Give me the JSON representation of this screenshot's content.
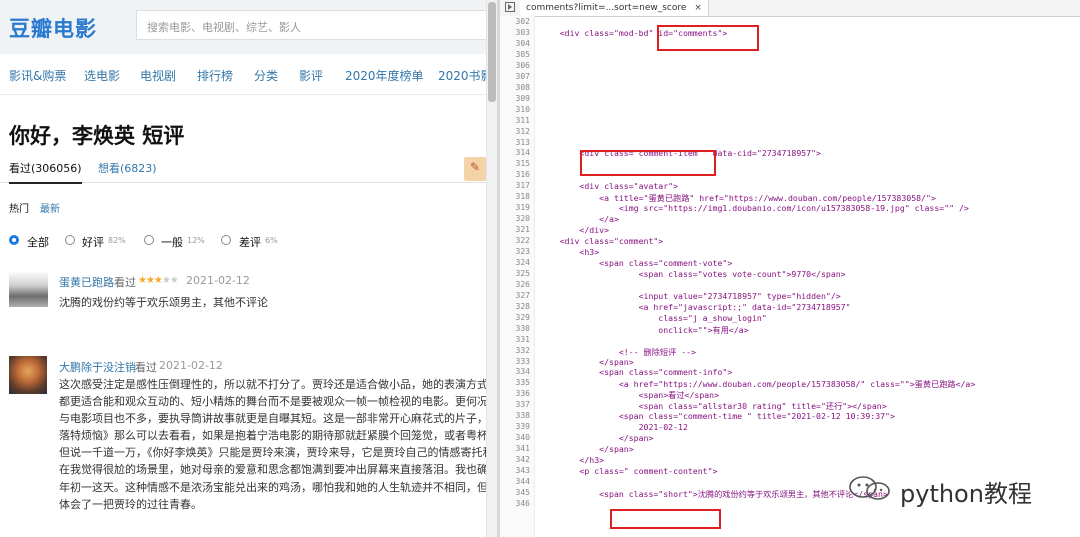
{
  "left_page": {
    "logo": "豆瓣电影",
    "search_placeholder": "搜索电影、电视剧、综艺、影人",
    "nav": [
      "影讯&购票",
      "选电影",
      "电视剧",
      "排行榜",
      "分类",
      "影评",
      "2020年度榜单",
      "2020书影"
    ],
    "title": "你好，李焕英 短评",
    "tabs": {
      "seen": "看过(306056)",
      "want_label": "想看",
      "want_count": "(6823)"
    },
    "sort": {
      "hot": "热门",
      "new": "最新"
    },
    "filters": [
      {
        "label": "全部",
        "pct": "",
        "selected": true
      },
      {
        "label": "好评",
        "pct": "82%",
        "selected": false
      },
      {
        "label": "一般",
        "pct": "12%",
        "selected": false
      },
      {
        "label": "差评",
        "pct": "6%",
        "selected": false
      }
    ],
    "comments": [
      {
        "user": "蛋黄已跑路",
        "status": "看过",
        "stars": 3,
        "date": "2021-02-12",
        "text": [
          "沈腾的戏份约等于欢乐颂男主，其他不评论"
        ]
      },
      {
        "user": "大鹏除于没注销",
        "status": "看过",
        "stars": 0,
        "date": "2021-02-12",
        "text": [
          "这次感受注定是感性压倒理性的，所以就不打分了。贾玲还是适合做小品，她的表演方式、她",
          "都更适合能和观众互动的、短小精炼的舞台而不是要被观众一帧一帧检视的电影。更何况她非",
          "与电影项目也不多，要执导筒讲故事就更是自曝其短。这是一部非常开心麻花式的片子，如果",
          "落特烦恼》那么可以去看看，如果是抱着宁浩电影的期待那就赶紧膜个回笼觉，或者粤杯咖啡",
          "但说一千道一万，《你好李焕英》只能是贾玲来演，贾玲来导，它是贾玲自己的情感寄托和内",
          "在我觉得很尬的场景里，她对母亲的爱意和思念都饱满到要冲出屏幕来直接落泪。我也确实接",
          "年初一这天。这种情感不是浓汤宝能兑出来的鸡汤，哪怕我和她的人生轨迹并不相同，但我也",
          "体会了一把贾玲的过往青春。"
        ]
      }
    ]
  },
  "devtools": {
    "tab_title": "comments?limit=...sort=new_score",
    "close": "×",
    "lines": [
      {
        "n": "302",
        "t": ""
      },
      {
        "n": "303",
        "t": "    <div class=\"mod-bd\" id=\"comments\">"
      },
      {
        "n": "304",
        "t": ""
      },
      {
        "n": "305",
        "t": ""
      },
      {
        "n": "306",
        "t": ""
      },
      {
        "n": "307",
        "t": ""
      },
      {
        "n": "308",
        "t": ""
      },
      {
        "n": "309",
        "t": ""
      },
      {
        "n": "310",
        "t": ""
      },
      {
        "n": "311",
        "t": ""
      },
      {
        "n": "312",
        "t": ""
      },
      {
        "n": "313",
        "t": ""
      },
      {
        "n": "314",
        "t": "        <div class=\"comment-item \" data-cid=\"2734718957\">"
      },
      {
        "n": "315",
        "t": ""
      },
      {
        "n": "316",
        "t": ""
      },
      {
        "n": "317",
        "t": "        <div class=\"avatar\">"
      },
      {
        "n": "318",
        "t": "            <a title=\"蛋黄已跑路\" href=\"https://www.douban.com/people/157383058/\">"
      },
      {
        "n": "319",
        "t": "                <img src=\"https://img1.doubanio.com/icon/u157383058-19.jpg\" class=\"\" />"
      },
      {
        "n": "320",
        "t": "            </a>"
      },
      {
        "n": "321",
        "t": "        </div>"
      },
      {
        "n": "322",
        "t": "    <div class=\"comment\">"
      },
      {
        "n": "323",
        "t": "        <h3>"
      },
      {
        "n": "324",
        "t": "            <span class=\"comment-vote\">"
      },
      {
        "n": "325",
        "t": "                    <span class=\"votes vote-count\">9770</span>"
      },
      {
        "n": "326",
        "t": ""
      },
      {
        "n": "327",
        "t": "                    <input value=\"2734718957\" type=\"hidden\"/>"
      },
      {
        "n": "328",
        "t": "                    <a href=\"javascript:;\" data-id=\"2734718957\""
      },
      {
        "n": "329",
        "t": "                        class=\"j a_show_login\""
      },
      {
        "n": "330",
        "t": "                        onclick=\"\">有用</a>"
      },
      {
        "n": "331",
        "t": ""
      },
      {
        "n": "332",
        "t": "                <!-- 删除短评 -->"
      },
      {
        "n": "333",
        "t": "            </span>"
      },
      {
        "n": "334",
        "t": "            <span class=\"comment-info\">"
      },
      {
        "n": "335",
        "t": "                <a href=\"https://www.douban.com/people/157383058/\" class=\"\">蛋黄已跑路</a>"
      },
      {
        "n": "336",
        "t": "                    <span>看过</span>"
      },
      {
        "n": "337",
        "t": "                    <span class=\"allstar30 rating\" title=\"还行\"></span>"
      },
      {
        "n": "338",
        "t": "                <span class=\"comment-time \" title=\"2021-02-12 10:39:37\">"
      },
      {
        "n": "339",
        "t": "                    2021-02-12"
      },
      {
        "n": "340",
        "t": "                </span>"
      },
      {
        "n": "341",
        "t": "            </span>"
      },
      {
        "n": "342",
        "t": "        </h3>"
      },
      {
        "n": "343",
        "t": "        <p class=\" comment-content\">"
      },
      {
        "n": "344",
        "t": ""
      },
      {
        "n": "345",
        "t": "            <span class=\"short\">沈腾的戏份约等于欢乐颂男主，其他不评论</span>"
      },
      {
        "n": "346",
        "t": ""
      }
    ]
  },
  "watermark": {
    "text": "python教程"
  }
}
